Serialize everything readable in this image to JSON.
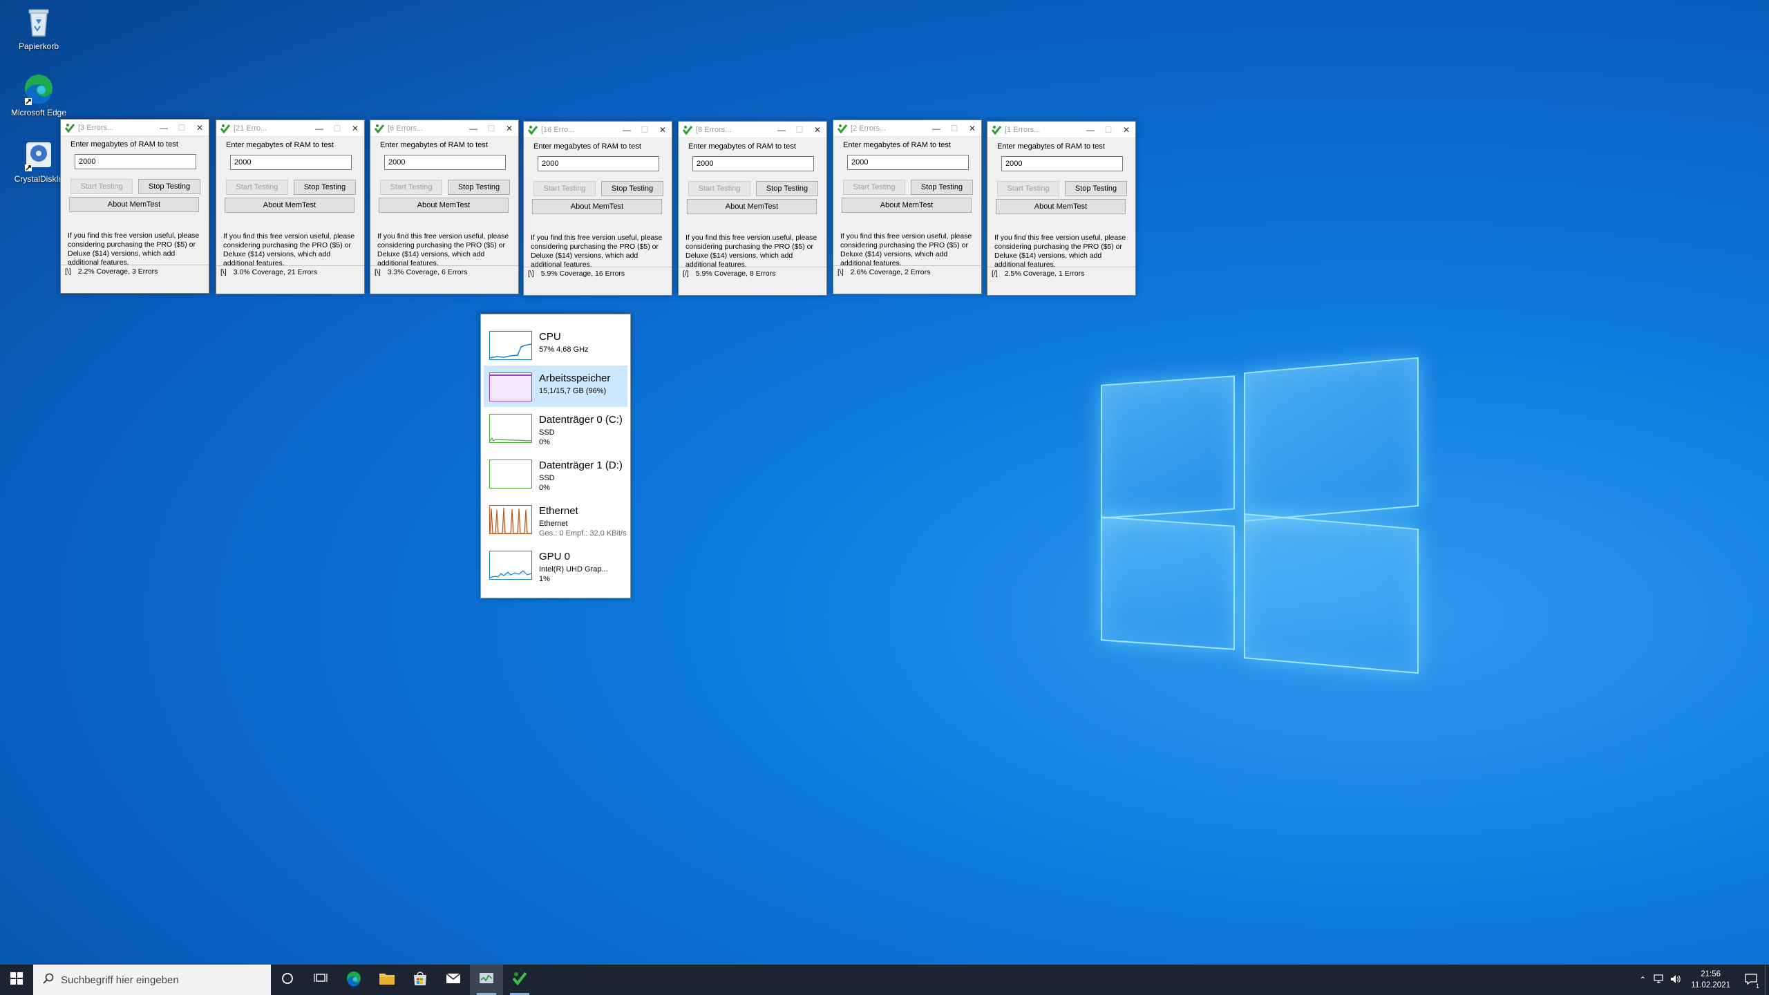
{
  "desktop": {
    "icons": [
      {
        "label": "Papierkorb"
      },
      {
        "label": "Microsoft Edge"
      },
      {
        "label": "CrystalDiskIn"
      }
    ]
  },
  "memtest": {
    "label": "Enter megabytes of RAM to test",
    "start_label": "Start Testing",
    "stop_label": "Stop Testing",
    "about_label": "About MemTest",
    "promo": "If you find this free version useful, please considering purchasing the PRO ($5) or Deluxe ($14) versions, which add additional features.",
    "windows": [
      {
        "title": "[3 Errors...",
        "value": "2000",
        "spinner": "[\\]",
        "status": "2.2% Coverage, 3 Errors"
      },
      {
        "title": "[21 Erro...",
        "value": "2000",
        "spinner": "[\\]",
        "status": "3.0% Coverage, 21 Errors"
      },
      {
        "title": "[6 Errors...",
        "value": "2000",
        "spinner": "[\\]",
        "status": "3.3% Coverage, 6 Errors"
      },
      {
        "title": "[16 Erro...",
        "value": "2000",
        "spinner": "[\\]",
        "status": "5.9% Coverage, 16 Errors"
      },
      {
        "title": "[8 Errors...",
        "value": "2000",
        "spinner": "[/]",
        "status": "5.9% Coverage, 8 Errors"
      },
      {
        "title": "[2 Errors...",
        "value": "2000",
        "spinner": "[\\]",
        "status": "2.6% Coverage, 2 Errors"
      },
      {
        "title": "[1 Errors...",
        "value": "2000",
        "spinner": "[/]",
        "status": "2.5% Coverage, 1 Errors"
      }
    ]
  },
  "taskmanager": {
    "items": [
      {
        "name": "CPU",
        "sub1": "57% 4,68 GHz",
        "sub2": "",
        "sub3": "",
        "color": "#1a7ec8"
      },
      {
        "name": "Arbeitsspeicher",
        "sub1": "15,1/15,7 GB (96%)",
        "sub2": "",
        "sub3": "",
        "color": "#9b3fc4"
      },
      {
        "name": "Datenträger 0 (C:)",
        "sub1": "SSD",
        "sub2": "0%",
        "sub3": "",
        "color": "#4ea72e"
      },
      {
        "name": "Datenträger 1 (D:)",
        "sub1": "SSD",
        "sub2": "0%",
        "sub3": "",
        "color": "#4ea72e"
      },
      {
        "name": "Ethernet",
        "sub1": "Ethernet",
        "sub2": "Ges.: 0 Empf.: 32,0 KBit/s",
        "sub3": "",
        "color": "#b8591b"
      },
      {
        "name": "GPU 0",
        "sub1": "Intel(R) UHD Grap...",
        "sub2": "1%",
        "sub3": "",
        "color": "#1a7ec8"
      }
    ]
  },
  "taskbar": {
    "search_placeholder": "Suchbegriff hier eingeben",
    "time": "21:56",
    "date": "11.02.2021",
    "notification_count": "1"
  }
}
